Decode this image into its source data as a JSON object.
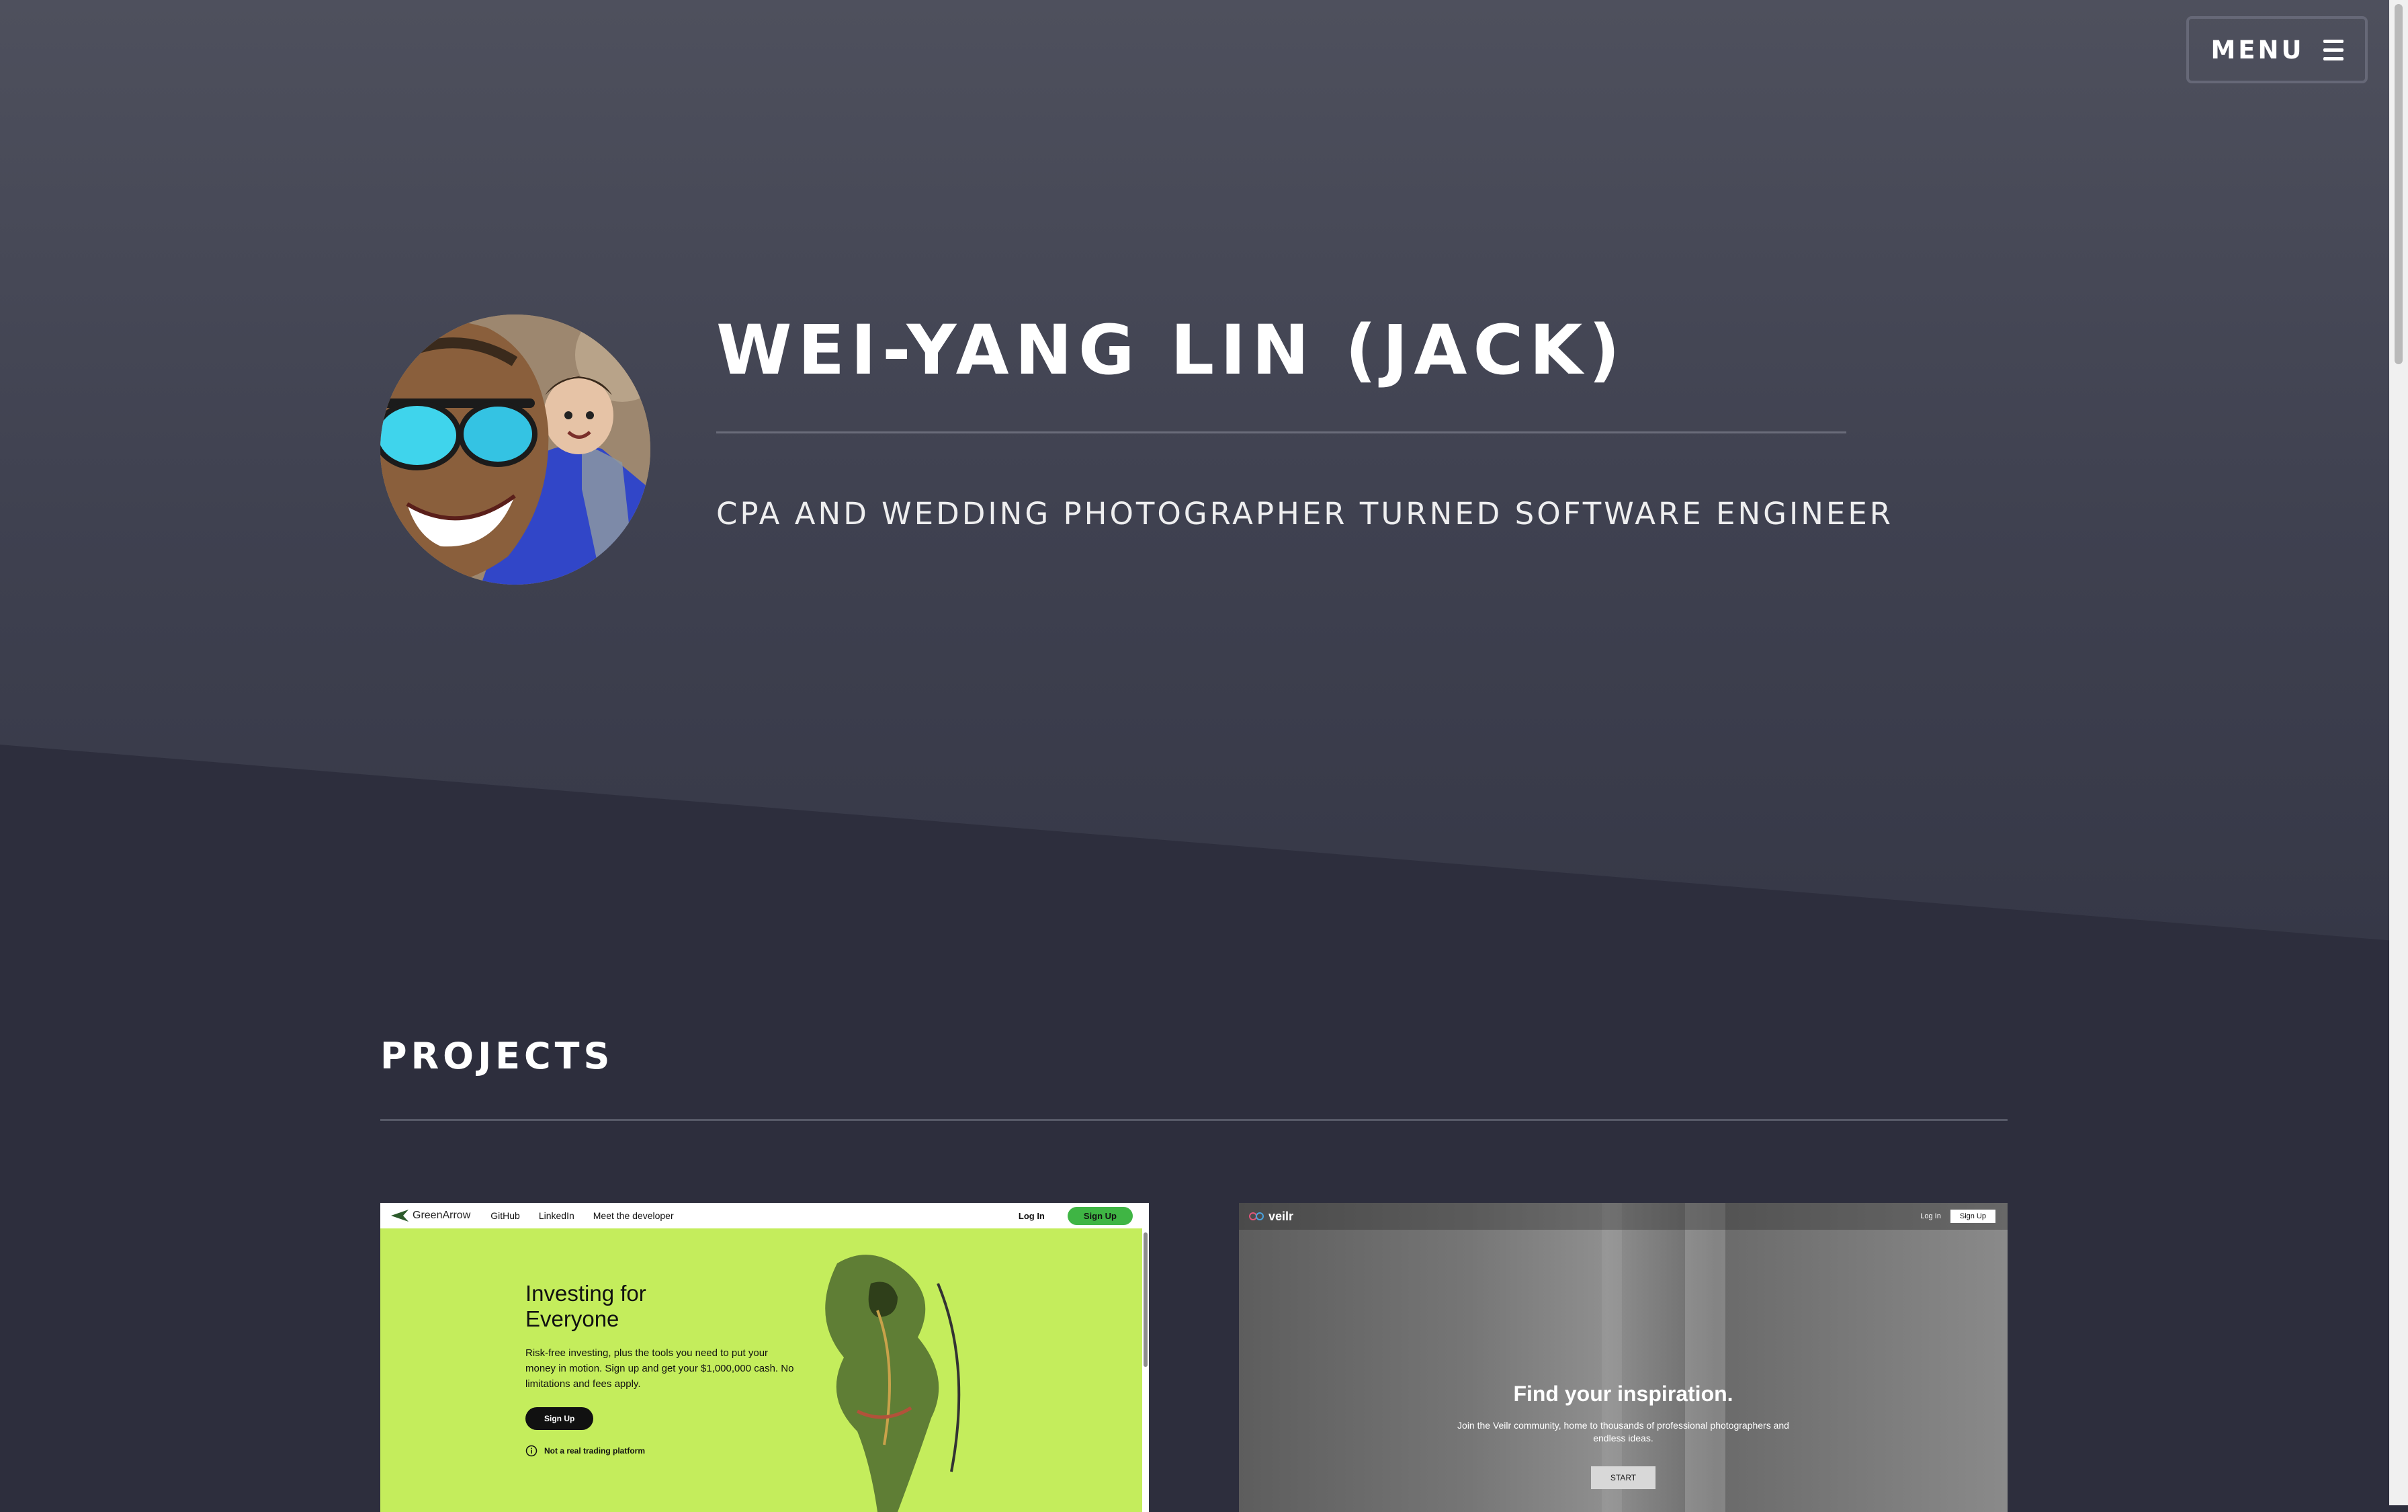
{
  "nav": {
    "menu_label": "MENU",
    "menu_icon": "hamburger-icon"
  },
  "hero": {
    "title": "WEI-YANG LIN (JACK)",
    "subtitle": "CPA AND WEDDING PHOTOGRAPHER TURNED SOFTWARE ENGINEER",
    "background_color": "#4e505d"
  },
  "projects": {
    "heading": "PROJECTS",
    "items": [
      {
        "name": "GreenArrow",
        "nav_links": [
          "GitHub",
          "LinkedIn",
          "Meet the developer"
        ],
        "login_label": "Log In",
        "signup_label": "Sign Up",
        "headline": "Investing for Everyone",
        "copy": "Risk-free investing, plus the tools you need to put your money in motion. Sign up and get your $1,000,000 cash. No limitations and fees apply.",
        "cta_label": "Sign Up",
        "note": "Not a real trading platform",
        "accent_color": "#c4ed5c"
      },
      {
        "name": "veilr",
        "login_label": "Log In",
        "signup_label": "Sign Up",
        "headline": "Find your inspiration.",
        "copy": "Join the Veilr community, home to thousands of professional photographers and endless ideas.",
        "cta_label": "START"
      }
    ]
  },
  "colors": {
    "page_background": "#2d2e3d",
    "divider": "#6a6c7a",
    "text": "#ffffff"
  }
}
